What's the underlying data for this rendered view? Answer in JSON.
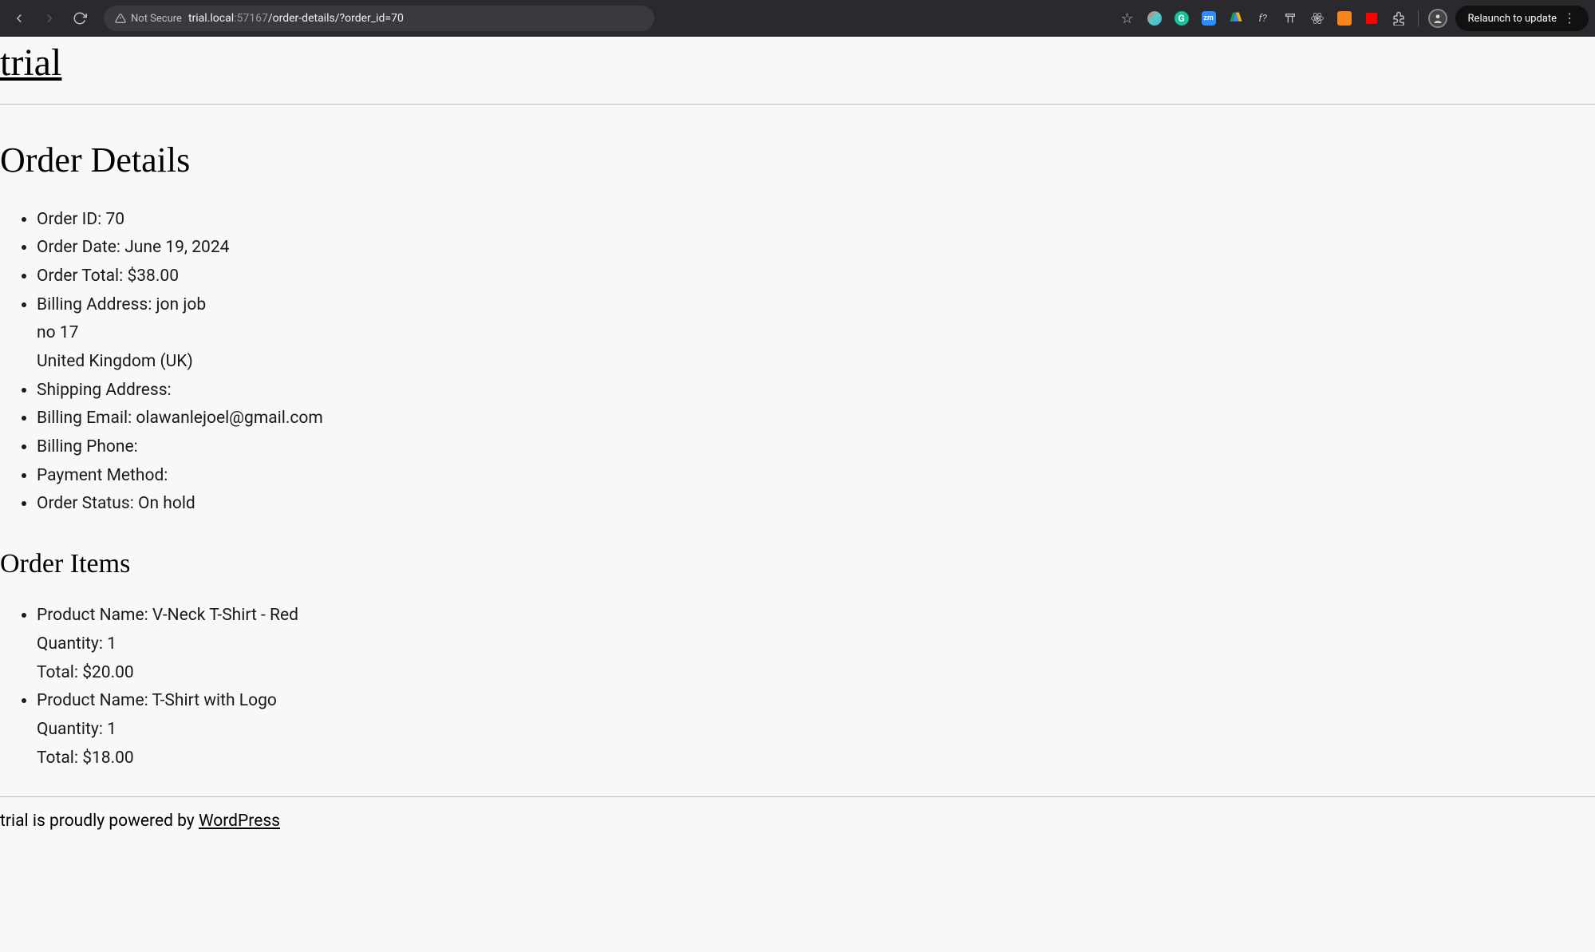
{
  "browser": {
    "security_label": "Not Secure",
    "url_domain": "trial.local",
    "url_port": ":57167",
    "url_path": "/order-details/?order_id=70",
    "relaunch_label": "Relaunch to update"
  },
  "site": {
    "title": "trial"
  },
  "page": {
    "heading": "Order Details",
    "items_heading": "Order Items"
  },
  "order": {
    "id_label": "Order ID: ",
    "id_value": "70",
    "date_label": "Order Date: ",
    "date_value": "June 19, 2024",
    "total_label": "Order Total: ",
    "total_value": "$38.00",
    "billing_address_label": "Billing Address: ",
    "billing_address_line1": "jon job",
    "billing_address_line2": "no 17",
    "billing_address_line3": "United Kingdom (UK)",
    "shipping_address_label": "Shipping Address:",
    "shipping_address_value": "",
    "billing_email_label": "Billing Email: ",
    "billing_email_value": "olawanlejoel@gmail.com",
    "billing_phone_label": "Billing Phone:",
    "billing_phone_value": "",
    "payment_method_label": "Payment Method:",
    "payment_method_value": "",
    "status_label": "Order Status: ",
    "status_value": "On hold"
  },
  "items": [
    {
      "name_label": "Product Name: ",
      "name_value": "V-Neck T-Shirt - Red",
      "qty_label": "Quantity: ",
      "qty_value": "1",
      "total_label": "Total: ",
      "total_value": "$20.00"
    },
    {
      "name_label": "Product Name: ",
      "name_value": "T-Shirt with Logo",
      "qty_label": "Quantity: ",
      "qty_value": "1",
      "total_label": "Total: ",
      "total_value": "$18.00"
    }
  ],
  "footer": {
    "prefix": "trial is proudly powered by ",
    "link_text": "WordPress"
  }
}
